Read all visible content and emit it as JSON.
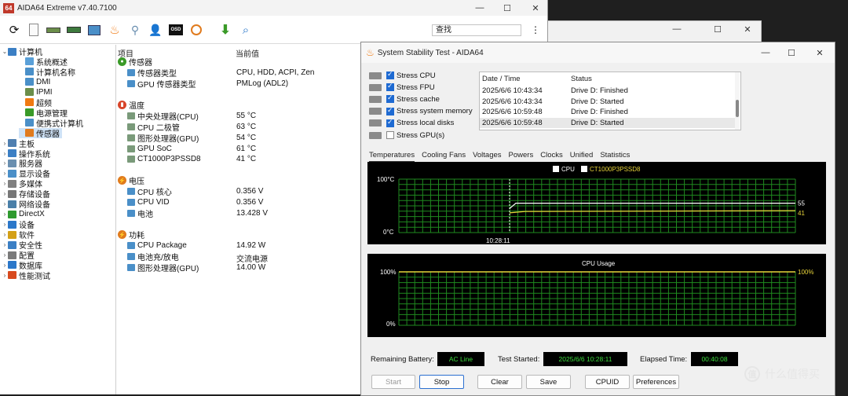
{
  "background_window": {
    "controls": [
      "—",
      "☐",
      "✕"
    ]
  },
  "main": {
    "title": "AIDA64 Extreme v7.40.7100",
    "app_badge": "64",
    "controls": [
      "—",
      "☐",
      "✕"
    ],
    "search_text": "查找",
    "more": "⋮",
    "toolbar_icons": [
      "refresh-icon",
      "report-icon",
      "motherboard-icon",
      "memory-icon",
      "computer-icon",
      "flame-icon",
      "network-icon",
      "users-icon",
      "osd-icon",
      "benchmark-icon",
      "update-down-icon",
      "search-icon"
    ],
    "tree": [
      {
        "label": "计算机",
        "expanded": true
      },
      {
        "label": "系统概述"
      },
      {
        "label": "计算机名称"
      },
      {
        "label": "DMI"
      },
      {
        "label": "IPMI"
      },
      {
        "label": "超频"
      },
      {
        "label": "电源管理"
      },
      {
        "label": "便携式计算机"
      },
      {
        "label": "传感器",
        "selected": true
      },
      {
        "label": "主板"
      },
      {
        "label": "操作系统"
      },
      {
        "label": "服务器"
      },
      {
        "label": "显示设备"
      },
      {
        "label": "多媒体"
      },
      {
        "label": "存储设备"
      },
      {
        "label": "网络设备"
      },
      {
        "label": "DirectX"
      },
      {
        "label": "设备"
      },
      {
        "label": "软件"
      },
      {
        "label": "安全性"
      },
      {
        "label": "配置"
      },
      {
        "label": "数据库"
      },
      {
        "label": "性能测试"
      }
    ],
    "list": {
      "col_item": "项目",
      "col_value": "当前值",
      "groups": [
        {
          "title": "传感器",
          "rows": [
            {
              "label": "传感器类型",
              "value": "CPU, HDD, ACPI, Zen"
            },
            {
              "label": "GPU 传感器类型",
              "value": "PMLog  (ADL2)"
            }
          ]
        },
        {
          "title": "温度",
          "rows": [
            {
              "label": "中央处理器(CPU)",
              "value": "55 °C"
            },
            {
              "label": "CPU 二极管",
              "value": "63 °C"
            },
            {
              "label": "图形处理器(GPU)",
              "value": "54 °C"
            },
            {
              "label": "GPU SoC",
              "value": "61 °C"
            },
            {
              "label": "CT1000P3PSSD8",
              "value": "41 °C"
            }
          ]
        },
        {
          "title": "电压",
          "rows": [
            {
              "label": "CPU 核心",
              "value": "0.356 V"
            },
            {
              "label": "CPU VID",
              "value": "0.356 V"
            },
            {
              "label": "电池",
              "value": "13.428 V"
            }
          ]
        },
        {
          "title": "功耗",
          "rows": [
            {
              "label": "CPU Package",
              "value": "14.92 W"
            },
            {
              "label": "电池充/放电",
              "value": "交流电源"
            },
            {
              "label": "图形处理器(GPU)",
              "value": "14.00 W"
            }
          ]
        }
      ]
    }
  },
  "stability": {
    "title": "System Stability Test - AIDA64",
    "controls": [
      "—",
      "☐",
      "✕"
    ],
    "stress": [
      {
        "label": "Stress CPU",
        "checked": true
      },
      {
        "label": "Stress FPU",
        "checked": true
      },
      {
        "label": "Stress cache",
        "checked": true
      },
      {
        "label": "Stress system memory",
        "checked": true
      },
      {
        "label": "Stress local disks",
        "checked": true
      },
      {
        "label": "Stress GPU(s)",
        "checked": false
      }
    ],
    "log": {
      "col_date": "Date / Time",
      "col_status": "Status",
      "rows": [
        {
          "date": "2025/6/6 10:43:34",
          "status": "Drive D: Finished"
        },
        {
          "date": "2025/6/6 10:43:34",
          "status": "Drive D: Started"
        },
        {
          "date": "2025/6/6 10:59:48",
          "status": "Drive D: Finished"
        },
        {
          "date": "2025/6/6 10:59:48",
          "status": "Drive D: Started"
        }
      ]
    },
    "tabs": [
      "Temperatures",
      "Cooling Fans",
      "Voltages",
      "Powers",
      "Clocks",
      "Unified",
      "Statistics"
    ],
    "active_tab": "Temperatures",
    "temp_chart": {
      "legend": [
        "CPU",
        "CT1000P3PSSD8"
      ],
      "y_top": "100°C",
      "y_bottom": "0°C",
      "x_label": "10:28:11",
      "end_values": [
        "55",
        "41"
      ],
      "colors": {
        "cpu": "#ffffff",
        "ssd": "#e8d43a",
        "grid": "#1f8a1f"
      },
      "cpu_value": 55,
      "ssd_value": 41
    },
    "usage_chart": {
      "title": "CPU Usage",
      "y_top": "100%",
      "y_bottom": "0%",
      "end_value": "100%",
      "usage_value": 100,
      "color": "#e8d43a"
    },
    "status": {
      "battery_label": "Remaining Battery:",
      "battery_value": "AC Line",
      "started_label": "Test Started:",
      "started_value": "2025/6/6 10:28:11",
      "elapsed_label": "Elapsed Time:",
      "elapsed_value": "00:40:08"
    },
    "buttons": {
      "start": "Start",
      "stop": "Stop",
      "clear": "Clear",
      "save": "Save",
      "cpuid": "CPUID",
      "preferences": "Preferences"
    }
  },
  "watermark": {
    "logo": "值",
    "text": "什么值得买"
  }
}
